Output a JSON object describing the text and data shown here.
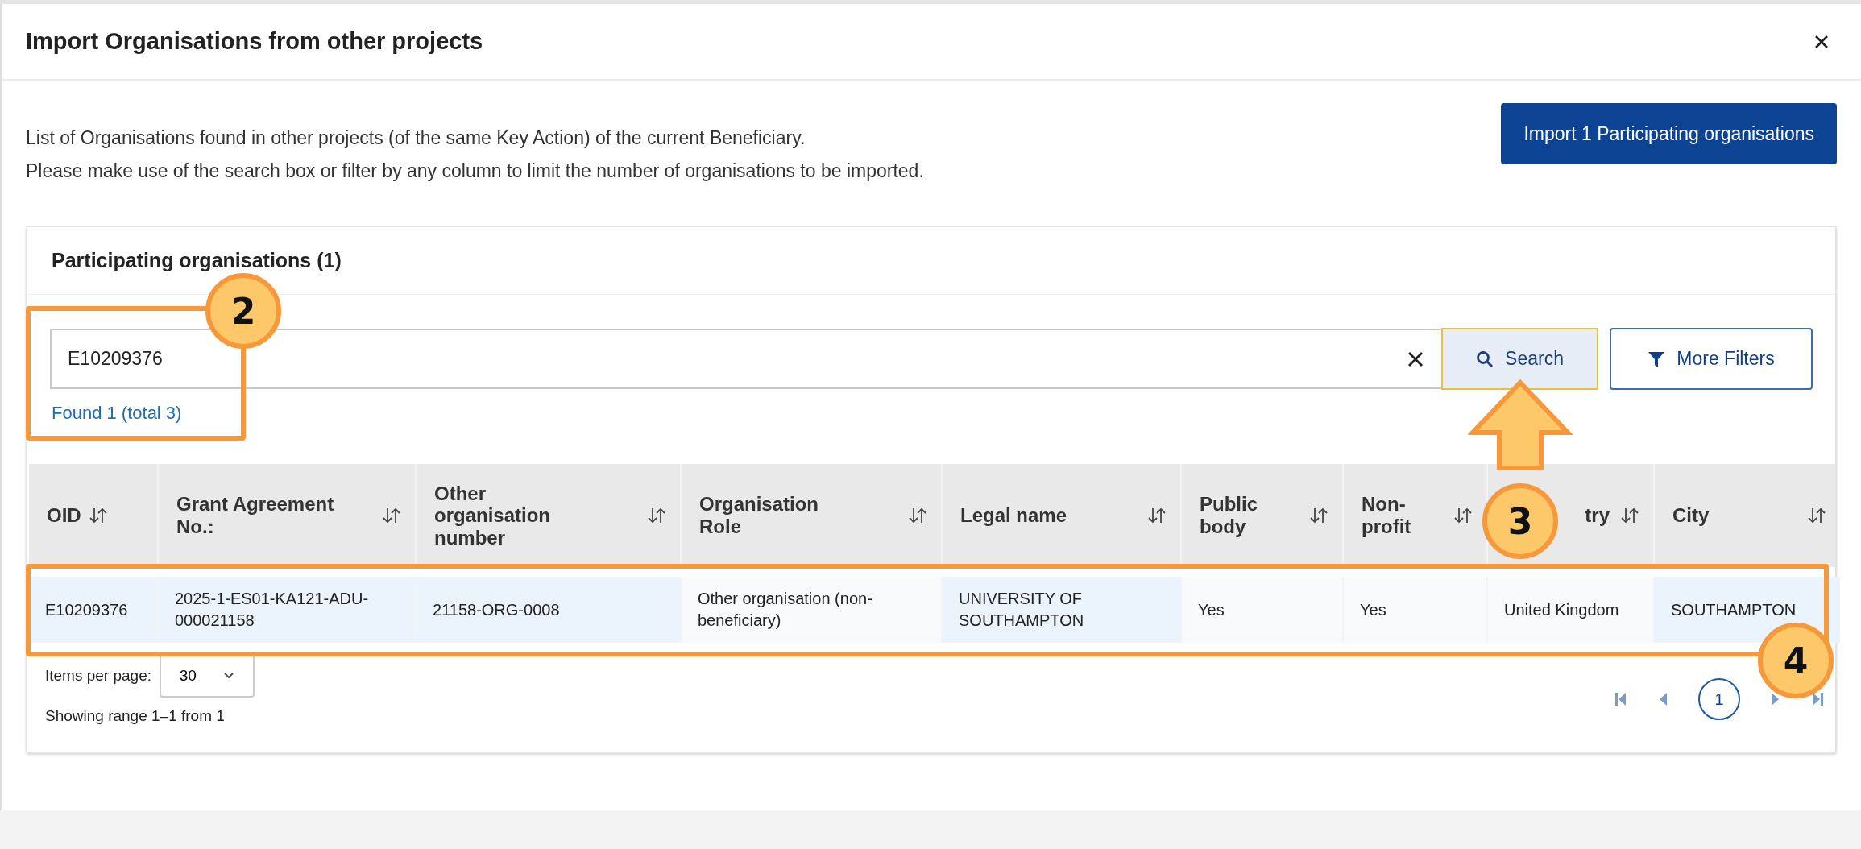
{
  "dialog": {
    "title": "Import Organisations from other projects"
  },
  "description": [
    "List of Organisations found in other projects (of the same Key Action) of the current Beneficiary.",
    "Please make use of the search box or filter by any column to limit the number of organisations to be imported."
  ],
  "import_button": "Import 1 Participating organisations",
  "card": {
    "title": "Participating organisations (1)",
    "search": {
      "value": "E10209376",
      "button": "Search",
      "filters_button": "More Filters",
      "found": "Found 1 (total 3)"
    },
    "table": {
      "columns": [
        {
          "label": "OID"
        },
        {
          "label": "Grant Agreement No.:"
        },
        {
          "label": "Other organisation number"
        },
        {
          "label": "Organisation Role"
        },
        {
          "label": "Legal name"
        },
        {
          "label": "Public body"
        },
        {
          "label": "Non-profit"
        },
        {
          "label": "try"
        },
        {
          "label": "City"
        }
      ],
      "rows": [
        {
          "cells": [
            "E10209376",
            "2025-1-ES01-KA121-ADU-000021158",
            "21158-ORG-0008",
            "Other organisation (non-beneficiary)",
            "UNIVERSITY OF SOUTHAMPTON",
            "Yes",
            "Yes",
            "United Kingdom",
            "SOUTHAMPTON"
          ]
        }
      ]
    },
    "items_per_page": {
      "label": "Items per page:",
      "value": "30"
    },
    "range": "Showing range 1–1 from 1",
    "pages": [
      {
        "label": "1",
        "selected": true
      }
    ]
  },
  "callouts": [
    {
      "number": "2"
    },
    {
      "number": "3"
    },
    {
      "number": "4"
    }
  ]
}
